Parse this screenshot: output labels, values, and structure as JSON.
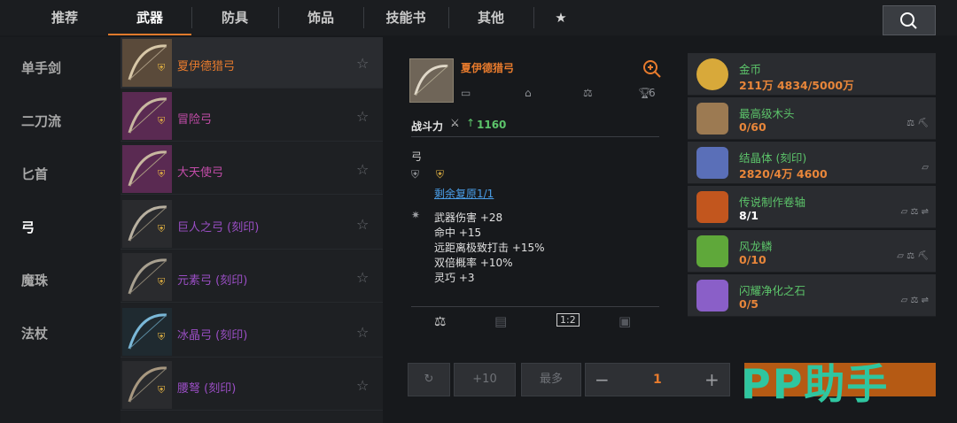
{
  "tabs": [
    "推荐",
    "武器",
    "防具",
    "饰品",
    "技能书",
    "其他",
    "★"
  ],
  "categories": [
    "单手剑",
    "二刀流",
    "匕首",
    "弓",
    "魔珠",
    "法杖"
  ],
  "items": [
    {
      "name": "夏伊德猎弓",
      "color": "#e87b2d"
    },
    {
      "name": "冒险弓",
      "color": "#c24ca8"
    },
    {
      "name": "大天使弓",
      "color": "#c24ca8"
    },
    {
      "name": "巨人之弓 (刻印)",
      "color": "#9a4ec4"
    },
    {
      "name": "元素弓 (刻印)",
      "color": "#9a4ec4"
    },
    {
      "name": "冰晶弓 (刻印)",
      "color": "#9a4ec4"
    },
    {
      "name": "腰弩 (刻印)",
      "color": "#9a4ec4"
    }
  ],
  "detail": {
    "title": "夏伊德猎弓",
    "trophy_count": "6",
    "power_label": "战斗力",
    "power_value": "1160",
    "type": "弓",
    "restore": "剩余复原1/1",
    "stats": [
      "武器伤害 +28",
      "命中 +15",
      "远距离极致打击 +15%",
      "双倍概率 +10%",
      "灵巧 +3"
    ]
  },
  "resources": [
    {
      "name": "金币",
      "value": "211万 4834/5000万",
      "value_white": false,
      "icon_color": "#d8a93a"
    },
    {
      "name": "最高级木头",
      "value": "0/60",
      "value_white": false,
      "icon_color": "#9c7a52"
    },
    {
      "name": "结晶体 (刻印)",
      "value": "2820/4万 4600",
      "value_white": false,
      "icon_color": "#5a6fb8"
    },
    {
      "name": "传说制作卷轴",
      "value": "8/1",
      "value_white": true,
      "icon_color": "#c2561e"
    },
    {
      "name": "风龙鳞",
      "value": "0/10",
      "value_white": false,
      "icon_color": "#5fa83a"
    },
    {
      "name": "闪耀净化之石",
      "value": "0/5",
      "value_white": false,
      "icon_color": "#8a5fc8"
    }
  ],
  "actions": {
    "plus10": "+10",
    "max": "最多",
    "minus": "−",
    "quantity": "1",
    "plus": "+"
  },
  "watermark": "PP助手"
}
